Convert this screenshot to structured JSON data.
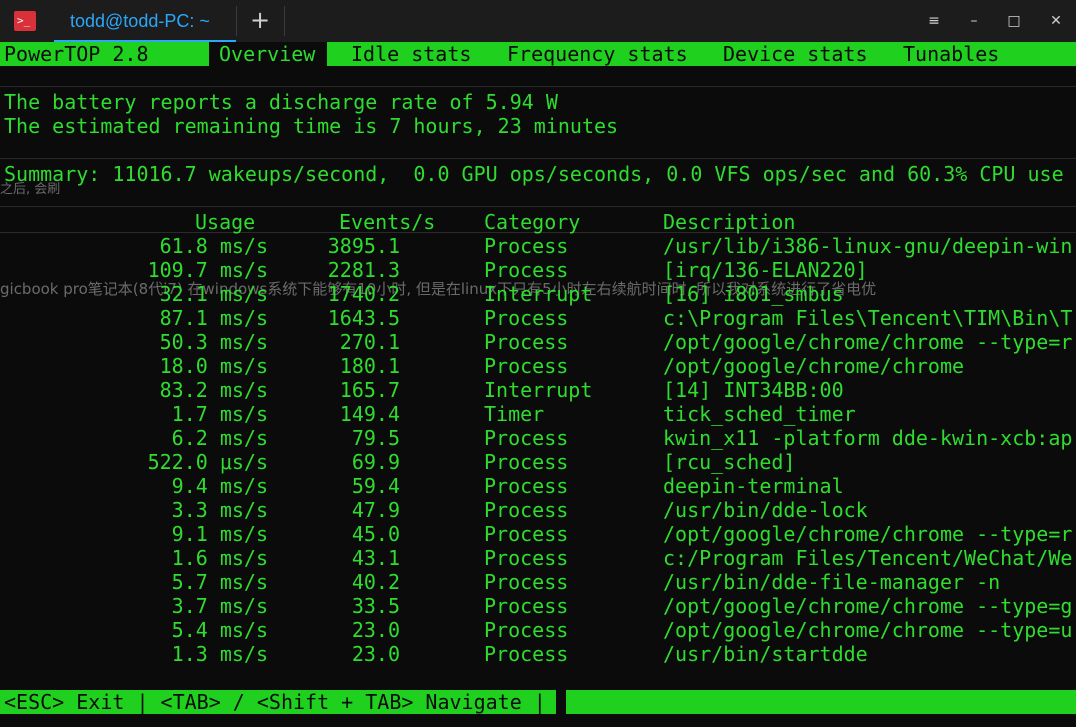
{
  "window": {
    "tab_title": "todd@todd-PC: ~",
    "add_tab": "+",
    "menu_glyph": "≡",
    "minimize_glyph": "–",
    "maximize_glyph": "□",
    "close_glyph": "✕",
    "app_icon_glyph": ">_"
  },
  "menu": {
    "app": "PowerTOP 2.8",
    "tabs": [
      "Overview",
      "Idle stats",
      "Frequency stats",
      "Device stats",
      "Tunables"
    ]
  },
  "battery": {
    "line1": "The battery reports a discharge rate of 5.94 W",
    "line2": "The estimated remaining time is 7 hours, 23 minutes"
  },
  "summary": "Summary: 11016.7 wakeups/second,  0.0 GPU ops/seconds, 0.0 VFS ops/sec and 60.3% CPU use",
  "bleed": {
    "line1": "之后, 会刷",
    "line2": "gicbook pro笔记本(8代i7) 在windows系统下能够有10小时, 但是在linux下只有5小时左右续航时间时, 所以我对系统进行了省电优"
  },
  "table": {
    "headers": {
      "usage": "Usage",
      "events": "Events/s",
      "category": "Category",
      "description": "Description"
    },
    "rows": [
      {
        "usage": "61.8 ms/s",
        "events": "3895.1",
        "category": "Process",
        "description": "/usr/lib/i386-linux-gnu/deepin-win"
      },
      {
        "usage": "109.7 ms/s",
        "events": "2281.3",
        "category": "Process",
        "description": "[irq/136-ELAN220]"
      },
      {
        "usage": "32.1 ms/s",
        "events": "1740.2",
        "category": "Interrupt",
        "description": "[16] i801_smbus"
      },
      {
        "usage": "87.1 ms/s",
        "events": "1643.5",
        "category": "Process",
        "description": "c:\\Program Files\\Tencent\\TIM\\Bin\\T"
      },
      {
        "usage": "50.3 ms/s",
        "events": "270.1",
        "category": "Process",
        "description": "/opt/google/chrome/chrome --type=r"
      },
      {
        "usage": "18.0 ms/s",
        "events": "180.1",
        "category": "Process",
        "description": "/opt/google/chrome/chrome"
      },
      {
        "usage": "83.2 ms/s",
        "events": "165.7",
        "category": "Interrupt",
        "description": "[14] INT34BB:00"
      },
      {
        "usage": "1.7 ms/s",
        "events": "149.4",
        "category": "Timer",
        "description": "tick_sched_timer"
      },
      {
        "usage": "6.2 ms/s",
        "events": "79.5",
        "category": "Process",
        "description": "kwin_x11 -platform dde-kwin-xcb:ap"
      },
      {
        "usage": "522.0 μs/s",
        "events": "69.9",
        "category": "Process",
        "description": "[rcu_sched]"
      },
      {
        "usage": "9.4 ms/s",
        "events": "59.4",
        "category": "Process",
        "description": "deepin-terminal"
      },
      {
        "usage": "3.3 ms/s",
        "events": "47.9",
        "category": "Process",
        "description": "/usr/bin/dde-lock"
      },
      {
        "usage": "9.1 ms/s",
        "events": "45.0",
        "category": "Process",
        "description": "/opt/google/chrome/chrome --type=r"
      },
      {
        "usage": "1.6 ms/s",
        "events": "43.1",
        "category": "Process",
        "description": "c:/Program Files/Tencent/WeChat/We"
      },
      {
        "usage": "5.7 ms/s",
        "events": "40.2",
        "category": "Process",
        "description": "/usr/bin/dde-file-manager -n"
      },
      {
        "usage": "3.7 ms/s",
        "events": "33.5",
        "category": "Process",
        "description": "/opt/google/chrome/chrome --type=g"
      },
      {
        "usage": "5.4 ms/s",
        "events": "23.0",
        "category": "Process",
        "description": "/opt/google/chrome/chrome --type=u"
      },
      {
        "usage": "1.3 ms/s",
        "events": "23.0",
        "category": "Process",
        "description": "/usr/bin/startdde"
      }
    ]
  },
  "footer": "<ESC> Exit | <TAB> / <Shift + TAB> Navigate |",
  "colors": {
    "terminal_green": "#2fdc2f",
    "bar_green": "#1fd01f",
    "tab_blue": "#2ca7f8",
    "background": "#0b0b0b"
  }
}
